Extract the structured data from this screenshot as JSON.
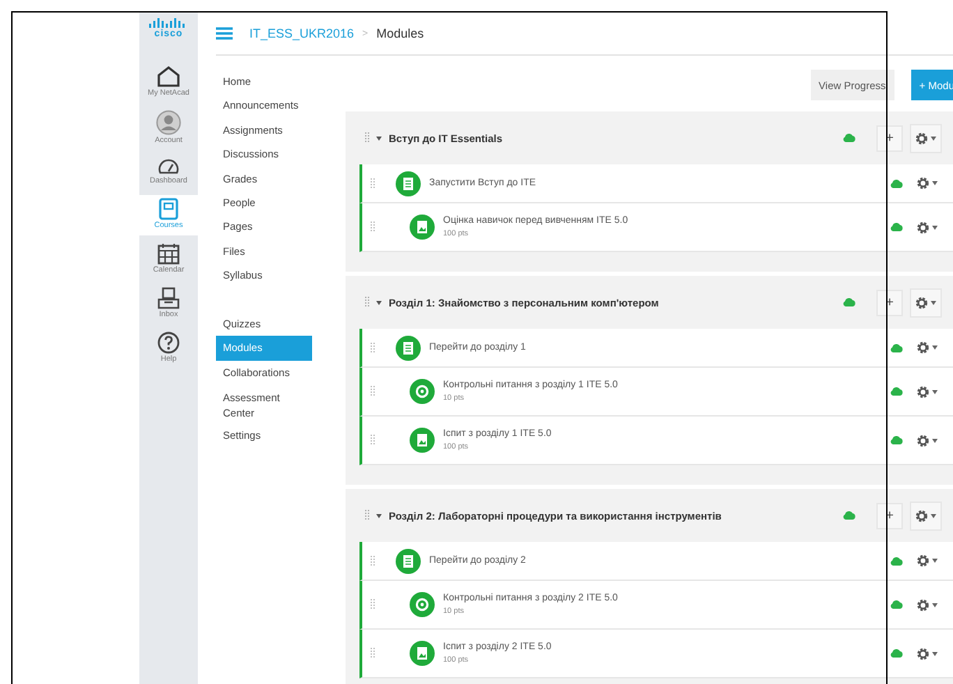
{
  "logo": "cisco",
  "global_nav": [
    {
      "label": "My NetAcad",
      "selected": false
    },
    {
      "label": "Account",
      "selected": false
    },
    {
      "label": "Dashboard",
      "selected": false
    },
    {
      "label": "Courses",
      "selected": true
    },
    {
      "label": "Calendar",
      "selected": false
    },
    {
      "label": "Inbox",
      "selected": false
    },
    {
      "label": "Help",
      "selected": false
    }
  ],
  "breadcrumb": {
    "course": "IT_ESS_UKR2016",
    "separator": ">",
    "page": "Modules"
  },
  "course_nav": [
    {
      "label": "Home",
      "selected": false
    },
    {
      "label": "Announcements",
      "selected": false
    },
    {
      "label": "Assignments",
      "selected": false
    },
    {
      "label": "Discussions",
      "selected": false
    },
    {
      "label": "Grades",
      "selected": false
    },
    {
      "label": "People",
      "selected": false
    },
    {
      "label": "Pages",
      "selected": false
    },
    {
      "label": "Files",
      "selected": false
    },
    {
      "label": "Syllabus",
      "selected": false
    },
    {
      "label": "Quizzes",
      "selected": false
    },
    {
      "label": "Modules",
      "selected": true
    },
    {
      "label": "Collaborations",
      "selected": false
    },
    {
      "label": "Assessment Center",
      "selected": false
    },
    {
      "label": "Settings",
      "selected": false
    }
  ],
  "buttons": [
    {
      "label": "View Progress",
      "kind": "default"
    },
    {
      "label": "+ Modu",
      "kind": "primary"
    }
  ],
  "modules": [
    {
      "title": "Вступ до IT Essentials",
      "add_label": "+",
      "published": true,
      "items": [
        {
          "kind": "page",
          "title": "Запустити Вступ до ITE",
          "published": true
        },
        {
          "kind": "assignment",
          "title": "Оцінка навичок перед вивченням ITE 5.0",
          "points": "100 pts",
          "published": true
        }
      ]
    },
    {
      "title": "Розділ 1: Знайомство з персональним комп'ютером",
      "add_label": "+",
      "published": true,
      "items": [
        {
          "kind": "page",
          "title": "Перейти до розділу 1",
          "published": true
        },
        {
          "kind": "quiz",
          "title": "Контрольні питання з розділу 1 ITE 5.0",
          "points": "10 pts",
          "published": true
        },
        {
          "kind": "assignment",
          "title": "Іспит з розділу 1 ITE 5.0",
          "points": "100 pts",
          "published": true
        }
      ]
    },
    {
      "title": "Розділ 2: Лабораторні процедури та використання інструментів",
      "add_label": "+",
      "published": true,
      "items": [
        {
          "kind": "page",
          "title": "Перейти до розділу 2",
          "published": true
        },
        {
          "kind": "quiz",
          "title": "Контрольні питання з розділу 2 ITE 5.0",
          "points": "10 pts",
          "published": true
        },
        {
          "kind": "assignment",
          "title": "Іспит з розділу 2 ITE 5.0",
          "points": "100 pts",
          "published": true
        }
      ]
    }
  ]
}
